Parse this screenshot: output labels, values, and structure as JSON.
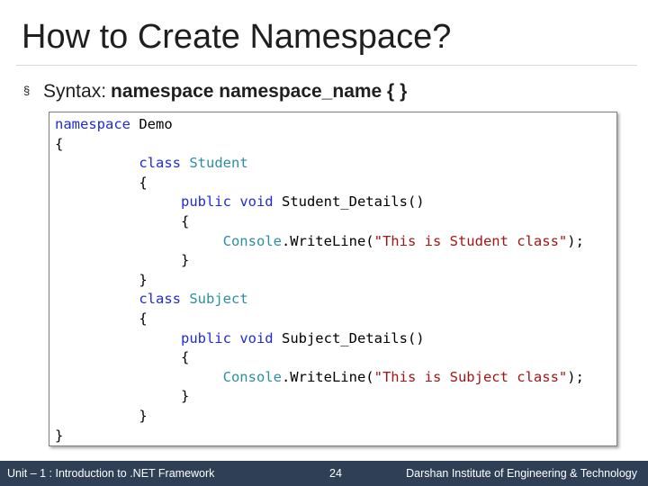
{
  "slide": {
    "title": "How to Create Namespace?",
    "bullet": {
      "mark": "§",
      "label": "Syntax:",
      "code": "namespace namespace_name {  }"
    }
  },
  "code": {
    "lines": [
      {
        "indent": "",
        "parts": [
          {
            "t": "namespace ",
            "c": "kw"
          },
          {
            "t": "Demo",
            "c": "plain"
          }
        ]
      },
      {
        "indent": "",
        "parts": [
          {
            "t": "{",
            "c": "plain"
          }
        ]
      },
      {
        "indent": "          ",
        "parts": [
          {
            "t": "class ",
            "c": "kw"
          },
          {
            "t": "Student",
            "c": "type"
          }
        ]
      },
      {
        "indent": "          ",
        "parts": [
          {
            "t": "{",
            "c": "plain"
          }
        ]
      },
      {
        "indent": "               ",
        "parts": [
          {
            "t": "public ",
            "c": "kw"
          },
          {
            "t": "void ",
            "c": "kw"
          },
          {
            "t": "Student_Details()",
            "c": "plain"
          }
        ]
      },
      {
        "indent": "               ",
        "parts": [
          {
            "t": "{",
            "c": "plain"
          }
        ]
      },
      {
        "indent": "                    ",
        "parts": [
          {
            "t": "Console",
            "c": "type"
          },
          {
            "t": ".WriteLine(",
            "c": "plain"
          },
          {
            "t": "\"This is Student class\"",
            "c": "str"
          },
          {
            "t": ");",
            "c": "plain"
          }
        ]
      },
      {
        "indent": "               ",
        "parts": [
          {
            "t": "}",
            "c": "plain"
          }
        ]
      },
      {
        "indent": "          ",
        "parts": [
          {
            "t": "}",
            "c": "plain"
          }
        ]
      },
      {
        "indent": "          ",
        "parts": [
          {
            "t": "class ",
            "c": "kw"
          },
          {
            "t": "Subject",
            "c": "type"
          }
        ]
      },
      {
        "indent": "          ",
        "parts": [
          {
            "t": "{",
            "c": "plain"
          }
        ]
      },
      {
        "indent": "               ",
        "parts": [
          {
            "t": "public ",
            "c": "kw"
          },
          {
            "t": "void ",
            "c": "kw"
          },
          {
            "t": "Subject_Details()",
            "c": "plain"
          }
        ]
      },
      {
        "indent": "               ",
        "parts": [
          {
            "t": "{",
            "c": "plain"
          }
        ]
      },
      {
        "indent": "                    ",
        "parts": [
          {
            "t": "Console",
            "c": "type"
          },
          {
            "t": ".WriteLine(",
            "c": "plain"
          },
          {
            "t": "\"This is Subject class\"",
            "c": "str"
          },
          {
            "t": ");",
            "c": "plain"
          }
        ]
      },
      {
        "indent": "               ",
        "parts": [
          {
            "t": "}",
            "c": "plain"
          }
        ]
      },
      {
        "indent": "          ",
        "parts": [
          {
            "t": "}",
            "c": "plain"
          }
        ]
      },
      {
        "indent": "",
        "parts": [
          {
            "t": "}",
            "c": "plain"
          }
        ]
      }
    ]
  },
  "footer": {
    "left": "Unit – 1 : Introduction to .NET Framework",
    "page_number": "24",
    "right": "Darshan Institute of Engineering & Technology"
  },
  "colors": {
    "keyword": "#1f2bd4",
    "type": "#2b8fa3",
    "string": "#a31515",
    "footer_bg": "#2e3f56"
  }
}
